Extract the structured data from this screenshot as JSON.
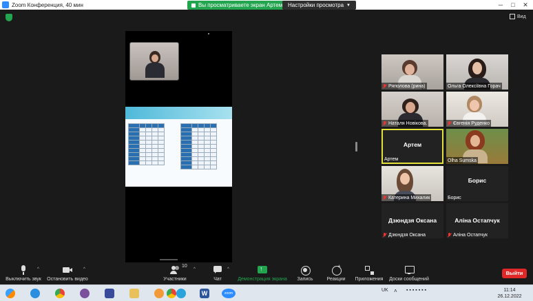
{
  "window": {
    "title": "Zoom Конференция, 40 мин",
    "share_banner": "Вы просматриваете экран Артем",
    "view_options": "Настройки просмотра",
    "view_button": "Вид"
  },
  "gallery": [
    {
      "name": "Ряполова (рина)",
      "muted": true,
      "video": true
    },
    {
      "name": "Ольга Олексіївна Горач",
      "muted": false,
      "video": true
    },
    {
      "name": "Наталя Новікова.",
      "muted": true,
      "video": true
    },
    {
      "name": "Євгенія Руденко",
      "muted": true,
      "video": true
    },
    {
      "name": "Артем",
      "big_label": "Артем",
      "muted": false,
      "video": false,
      "active_speaker": true
    },
    {
      "name": "Olha Sumska",
      "muted": false,
      "video": true
    },
    {
      "name": "Катерина Михалик",
      "muted": true,
      "video": true
    },
    {
      "name": "Борис",
      "big_label": "Борис",
      "muted": false,
      "video": false
    },
    {
      "name": "Дзюндзя Оксана",
      "big_label": "Дзюндзя Оксана",
      "muted": true,
      "video": false
    },
    {
      "name": "Аліна Остапчук",
      "big_label": "Аліна Остапчук",
      "muted": true,
      "video": false
    }
  ],
  "toolbar": {
    "mute": "Выключить звук",
    "stop_video": "Остановить видео",
    "participants": "Участники",
    "participants_count": "10",
    "chat": "Чат",
    "share_screen": "Демонстрация экрана",
    "record": "Запись",
    "reactions": "Реакции",
    "apps": "Приложения",
    "whiteboards": "Доски сообщений",
    "leave": "Выйти"
  },
  "taskbar": {
    "lang": "UK",
    "time": "11:14",
    "date": "26.12.2022",
    "apps": [
      "start",
      "ie",
      "chrome",
      "viber",
      "save",
      "explorer",
      "skype",
      "chrome2",
      "telegram",
      "word",
      "zoom"
    ],
    "zoom_label": "zoom",
    "word_label": "W"
  },
  "colors": {
    "accent_green": "#23a54f",
    "leave_red": "#e02828",
    "active_border": "#e6e23d"
  }
}
